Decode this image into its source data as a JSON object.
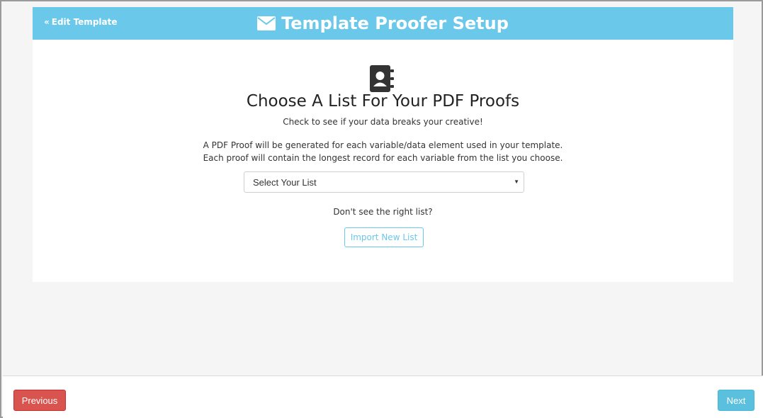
{
  "header": {
    "back_label": "Edit Template",
    "title": "Template Proofer Setup",
    "bar_color": "#6ac8ea"
  },
  "content": {
    "icon": "contact-book-icon",
    "title": "Choose A List For Your PDF Proofs",
    "subtitle": "Check to see if your data breaks your creative!",
    "desc_line1": "A PDF Proof will be generated for each variable/data element used in your template.",
    "desc_line2": "Each proof will contain the longest record for each variable from the list you choose.",
    "select_value": "Select Your List",
    "dont_see": "Don't see the right list?",
    "import_label": "Import New List"
  },
  "footer": {
    "previous_label": "Previous",
    "next_label": "Next",
    "previous_color": "#d9534f",
    "next_color": "#5bc0de"
  }
}
